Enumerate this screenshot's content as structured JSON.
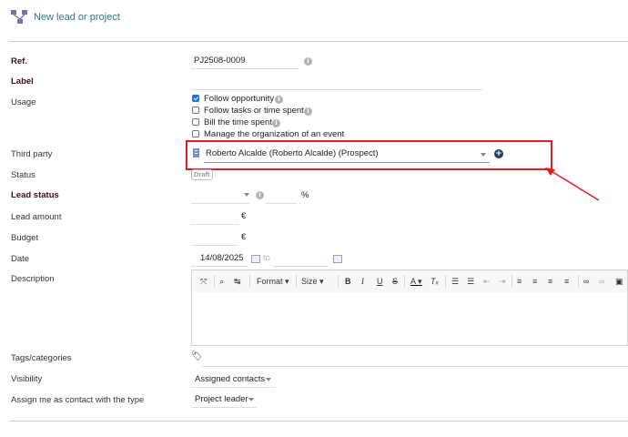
{
  "header": {
    "title": "New lead or project",
    "icon": "project-icon"
  },
  "form": {
    "ref": {
      "label": "Ref.",
      "value": "PJ2508-0009"
    },
    "label_field": {
      "label": "Label",
      "value": ""
    },
    "usage": {
      "label": "Usage",
      "options": [
        {
          "label": "Follow opportunity",
          "checked": true
        },
        {
          "label": "Follow tasks or time spent",
          "checked": false
        },
        {
          "label": "Bill the time spent",
          "checked": false
        },
        {
          "label": "Manage the organization of an event",
          "checked": false
        }
      ]
    },
    "third_party": {
      "label": "Third party",
      "value": "Roberto Alcalde (Roberto Alcalde) (Prospect)"
    },
    "status": {
      "label": "Status",
      "value": "Draft"
    },
    "lead_status": {
      "label": "Lead status",
      "value": "",
      "percent_symbol": "%"
    },
    "lead_amount": {
      "label": "Lead amount",
      "currency": "€"
    },
    "budget": {
      "label": "Budget",
      "currency": "€"
    },
    "date": {
      "label": "Date",
      "start": "14/08/2025",
      "to_label": "to",
      "end": ""
    },
    "description": {
      "label": "Description",
      "toolbar": {
        "format_label": "Format",
        "size_label": "Size"
      }
    },
    "tags": {
      "label": "Tags/categories"
    },
    "visibility": {
      "label": "Visibility",
      "value": "Assigned contacts"
    },
    "assign_me": {
      "label": "Assign me as contact with the type",
      "value": "Project leader"
    }
  },
  "colors": {
    "annotation": "#e51c23",
    "title": "#2d7686",
    "label_dark": "#3d0c16",
    "checkbox": "#1976d2"
  }
}
